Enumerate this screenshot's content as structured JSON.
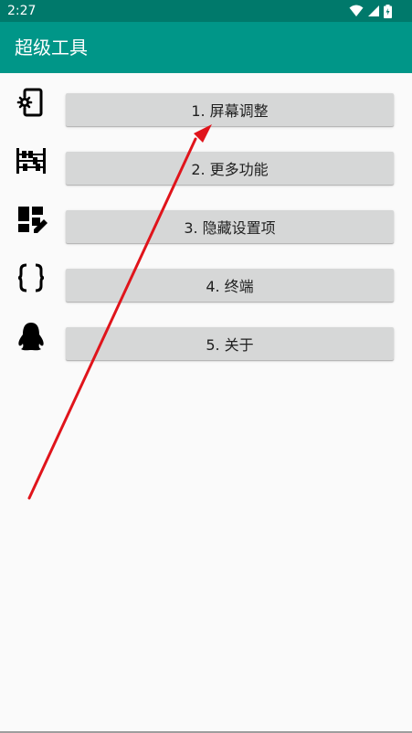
{
  "status_bar": {
    "time": "2:27"
  },
  "app_bar": {
    "title": "超级工具"
  },
  "menu": {
    "items": [
      {
        "label": "1. 屏幕调整",
        "icon": "phone-settings-icon"
      },
      {
        "label": "2. 更多功能",
        "icon": "abacus-icon"
      },
      {
        "label": "3. 隐藏设置项",
        "icon": "dashboard-edit-icon"
      },
      {
        "label": "4. 终端",
        "icon": "code-braces-icon"
      },
      {
        "label": "5. 关于",
        "icon": "penguin-icon"
      }
    ]
  },
  "colors": {
    "status_bar": "#00796b",
    "app_bar": "#009688",
    "button": "#d6d7d7",
    "background": "#fafafa",
    "annotation_arrow": "#e0141b"
  }
}
